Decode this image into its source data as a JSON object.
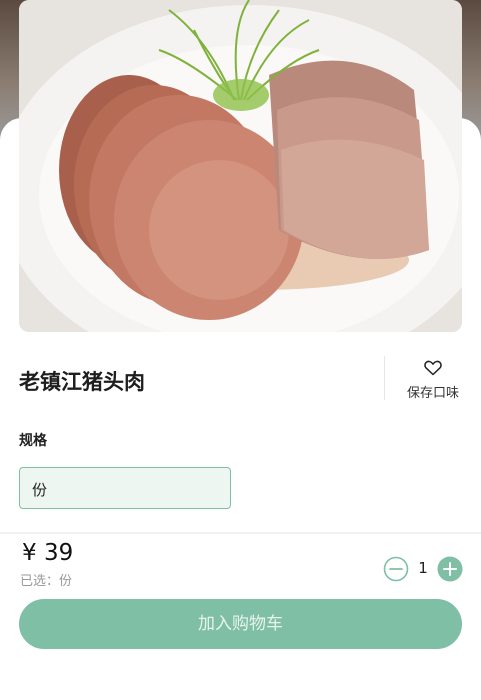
{
  "product": {
    "name": "老镇江猪头肉",
    "image_icon": "dish-photo"
  },
  "favorite": {
    "label": "保存口味",
    "icon": "heart-icon"
  },
  "spec": {
    "label": "规格",
    "options": [
      "份"
    ],
    "selected": "份"
  },
  "footer": {
    "price": "¥ 39",
    "selected_text": "已选：份",
    "quantity": "1",
    "add_to_cart_label": "加入购物车"
  },
  "colors": {
    "accent": "#7fbfa5",
    "accent_light": "#eef6f2",
    "accent_border": "#7fbfa8"
  }
}
